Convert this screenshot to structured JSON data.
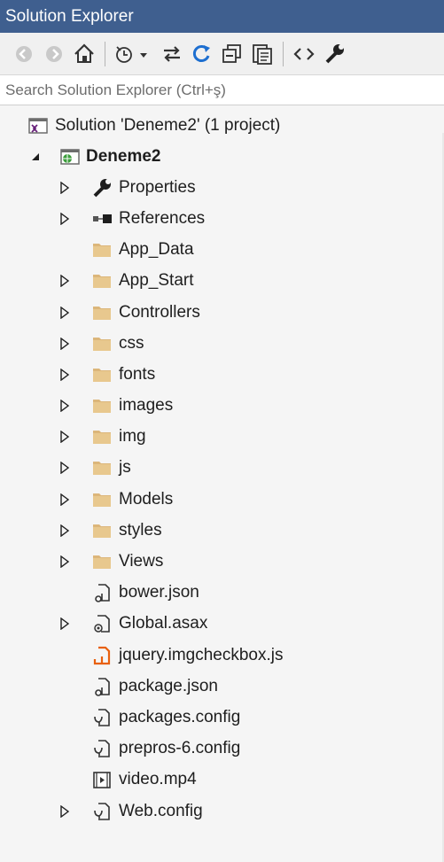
{
  "title": "Solution Explorer",
  "search": {
    "placeholder": "Search Solution Explorer (Ctrl+ş)"
  },
  "toolbar": {
    "buttons": [
      "back-icon",
      "forward-icon",
      "home-icon",
      "history-icon",
      "sync-icon",
      "refresh-icon",
      "collapse-all-icon",
      "show-all-files-icon",
      "view-code-icon",
      "properties-wrench-icon"
    ]
  },
  "solution": {
    "label": "Solution 'Deneme2' (1 project)"
  },
  "project": {
    "label": "Deneme2"
  },
  "items": [
    {
      "label": "Properties",
      "icon": "wrench-icon",
      "expandable": true
    },
    {
      "label": "References",
      "icon": "references-icon",
      "expandable": true
    },
    {
      "label": "App_Data",
      "icon": "folder-icon",
      "expandable": false
    },
    {
      "label": "App_Start",
      "icon": "folder-icon",
      "expandable": true
    },
    {
      "label": "Controllers",
      "icon": "folder-icon",
      "expandable": true
    },
    {
      "label": "css",
      "icon": "folder-icon",
      "expandable": true
    },
    {
      "label": "fonts",
      "icon": "folder-icon",
      "expandable": true
    },
    {
      "label": "images",
      "icon": "folder-icon",
      "expandable": true
    },
    {
      "label": "img",
      "icon": "folder-icon",
      "expandable": true
    },
    {
      "label": "js",
      "icon": "folder-icon",
      "expandable": true
    },
    {
      "label": "Models",
      "icon": "folder-icon",
      "expandable": true
    },
    {
      "label": "styles",
      "icon": "folder-icon",
      "expandable": true
    },
    {
      "label": "Views",
      "icon": "folder-icon",
      "expandable": true
    },
    {
      "label": "bower.json",
      "icon": "json-file-icon",
      "expandable": false
    },
    {
      "label": "Global.asax",
      "icon": "asax-file-icon",
      "expandable": true
    },
    {
      "label": "jquery.imgcheckbox.js",
      "icon": "js-file-icon",
      "expandable": false
    },
    {
      "label": "package.json",
      "icon": "json-file-icon",
      "expandable": false
    },
    {
      "label": "packages.config",
      "icon": "config-file-icon",
      "expandable": false
    },
    {
      "label": "prepros-6.config",
      "icon": "config-file-icon",
      "expandable": false
    },
    {
      "label": "video.mp4",
      "icon": "video-file-icon",
      "expandable": false
    },
    {
      "label": "Web.config",
      "icon": "config-file-icon",
      "expandable": true
    }
  ]
}
